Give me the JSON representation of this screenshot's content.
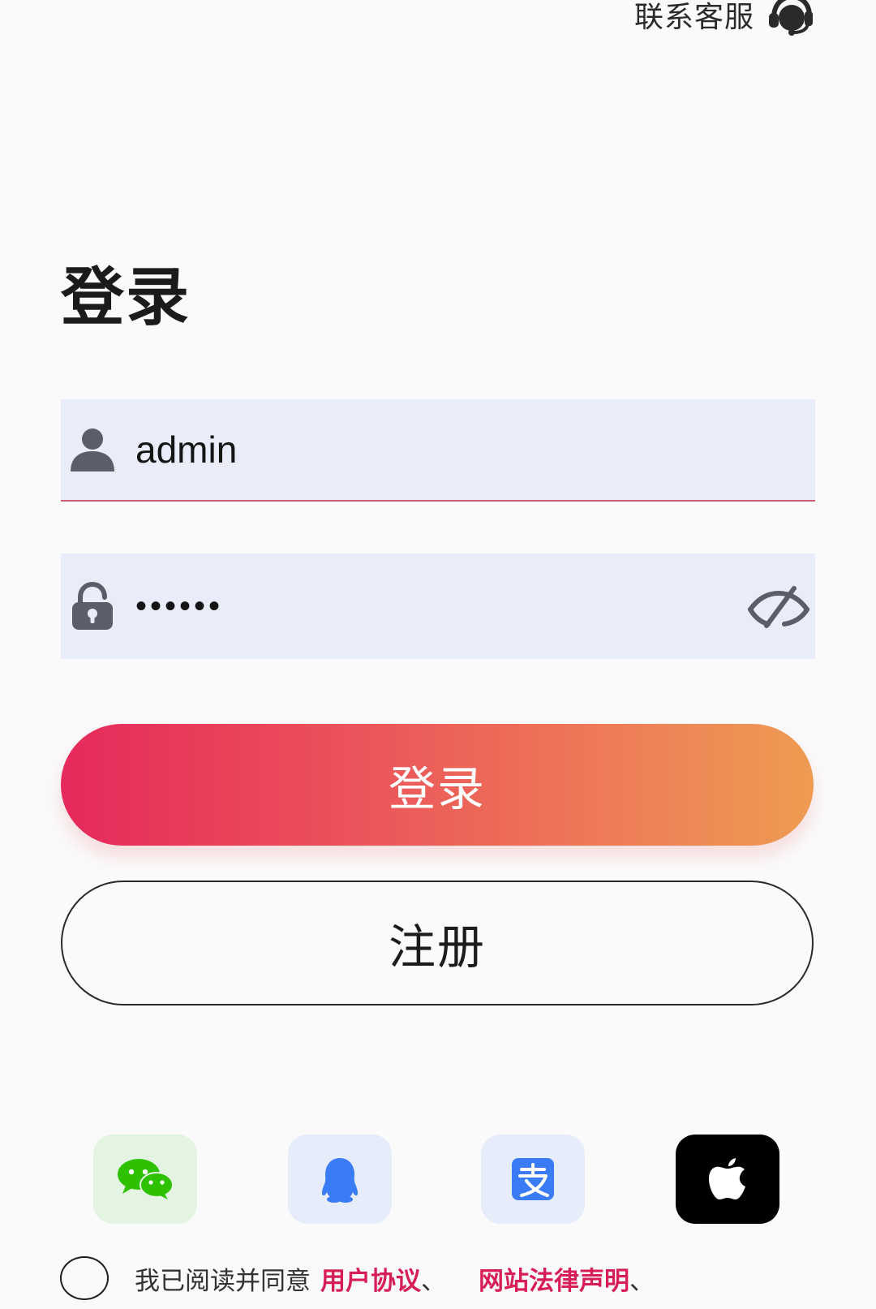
{
  "header": {
    "customer_service_label": "联系客服",
    "customer_service_icon": "headset-icon"
  },
  "login": {
    "title": "登录",
    "username": {
      "value": "admin",
      "icon": "user-icon"
    },
    "password": {
      "value": "••••••",
      "icon": "lock-icon",
      "toggle_icon": "eye-off-icon"
    },
    "login_button_label": "登录",
    "register_button_label": "注册"
  },
  "social": [
    {
      "name": "wechat",
      "icon": "wechat-icon",
      "color": "#2dc100"
    },
    {
      "name": "qq",
      "icon": "qq-icon",
      "color": "#3a7cf5"
    },
    {
      "name": "alipay",
      "icon": "alipay-icon",
      "color": "#3a7cf5"
    },
    {
      "name": "apple",
      "icon": "apple-icon",
      "color": "#000000"
    }
  ],
  "agreement": {
    "prefix": "我已阅读并同意",
    "links": [
      {
        "label": "用户协议",
        "separator": "、"
      },
      {
        "label": "网站法律声明",
        "separator": "、"
      }
    ]
  },
  "colors": {
    "accent": "#e6295b",
    "accent_end": "#ee9b52",
    "field_bg": "#e8edf9",
    "link": "#d81e56"
  }
}
